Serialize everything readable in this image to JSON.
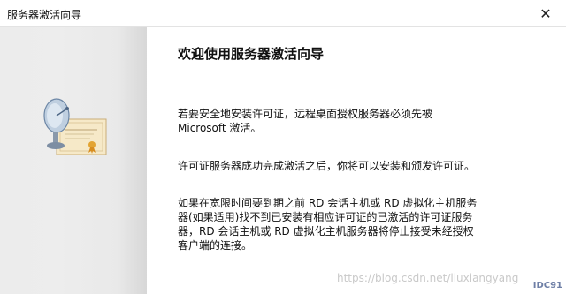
{
  "window": {
    "title": "服务器激活向导",
    "close_symbol": "✕"
  },
  "sidebar": {
    "image_icon": "satellite-dish-certificate-icon"
  },
  "content": {
    "heading": "欢迎使用服务器激活向导",
    "paragraph1": [
      "若要安全地安装许可证，远程桌面授权服务器必须先被",
      "Microsoft 激活。"
    ],
    "paragraph2": "许可证服务器成功完成激活之后，你将可以安装和颁发许可证。",
    "paragraph3": [
      "如果在宽限时间要到期之前 RD 会话主机或 RD 虚拟化主机服务",
      "器(如果适用)找不到已安装有相应许可证的已激活的许可证服务",
      "器，RD 会话主机或 RD 虚拟化主机服务器将停止接受未经授权",
      "客户端的连接。"
    ]
  },
  "watermark": "https://blog.csdn.net/liuxiangyang",
  "corner_mark": "IDC91"
}
